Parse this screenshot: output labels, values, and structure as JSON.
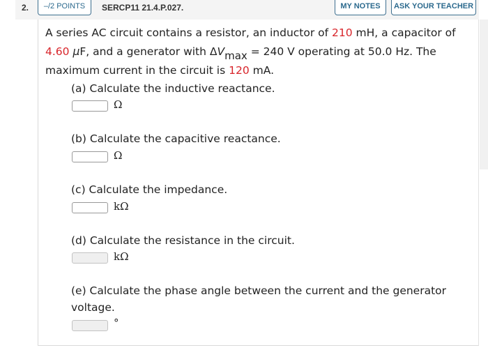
{
  "header": {
    "question_number": "2.",
    "points": "–/2 POINTS",
    "problem_id": "SERCP11 21.4.P.027.",
    "my_notes_label": "MY NOTES",
    "ask_teacher_label": "ASK YOUR TEACHER"
  },
  "problem": {
    "t1": "A series AC circuit contains a resistor, an inductor of ",
    "inductance_value": "210",
    "t2": " mH, a capacitor of ",
    "capacitance_value": "4.60",
    "t3": " ",
    "mu": "μ",
    "t4": "F, and a generator with Δ",
    "v_symbol": "V",
    "v_sub": "max",
    "t5": " = 240 V operating at 50.0 Hz. The maximum current in the circuit is ",
    "current_value": "120",
    "t6": " mA."
  },
  "parts": [
    {
      "label": "(a) Calculate the inductive reactance.",
      "value": "",
      "unit": "Ω",
      "enabled": true
    },
    {
      "label": "(b) Calculate the capacitive reactance.",
      "value": "",
      "unit": "Ω",
      "enabled": true
    },
    {
      "label": "(c) Calculate the impedance.",
      "value": "",
      "unit": "kΩ",
      "enabled": true
    },
    {
      "label": "(d) Calculate the resistance in the circuit.",
      "value": "",
      "unit": "kΩ",
      "enabled": false
    },
    {
      "label_line1": "(e) Calculate the phase angle between the current and the generator",
      "label_line2": "voltage.",
      "value": "",
      "unit": "°",
      "enabled": false
    }
  ],
  "colors": {
    "accent": "#2c6a8e",
    "given_value": "#d8252b"
  }
}
